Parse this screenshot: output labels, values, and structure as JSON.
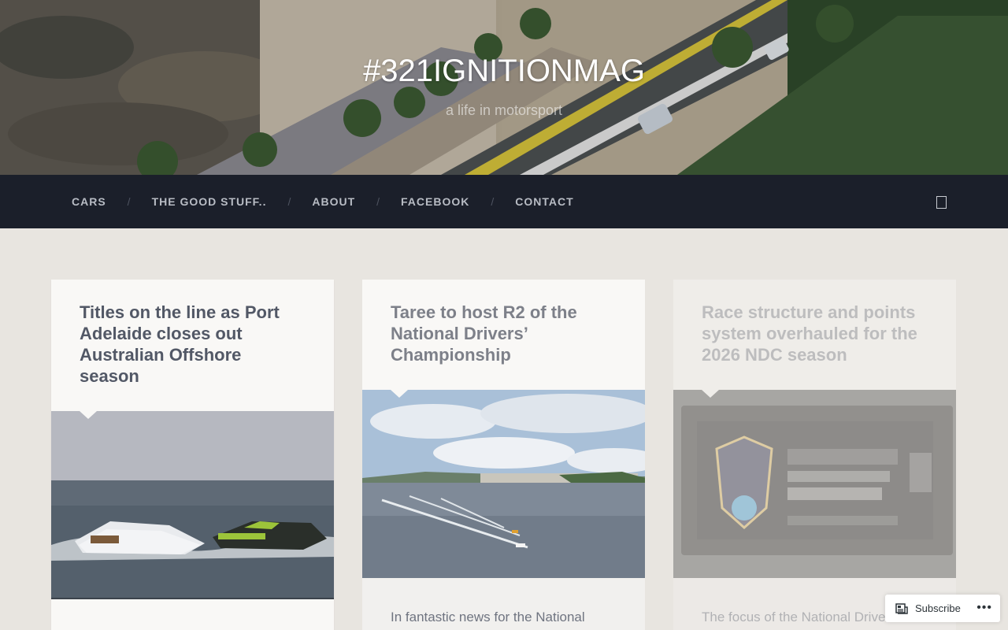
{
  "site": {
    "title": "#321IGNITIONMAG",
    "tagline": "a life in motorsport"
  },
  "nav": {
    "items": [
      {
        "label": "CARS"
      },
      {
        "label": "THE GOOD STUFF.."
      },
      {
        "label": "ABOUT"
      },
      {
        "label": "FACEBOOK"
      },
      {
        "label": "CONTACT"
      }
    ],
    "separator": "/",
    "search_icon": "search-toggle-icon"
  },
  "posts": [
    {
      "title": "Titles on the line as Port Adelaide closes out Australian Offshore season",
      "image": "offshore-powerboats-photo",
      "excerpt": ""
    },
    {
      "title": "Taree to host R2 of the National Drivers’ Championship",
      "image": "jetski-river-aerial-photo",
      "excerpt": "In fantastic news for the National"
    },
    {
      "title": "Race structure and points system overhauled for the 2026 NDC season",
      "image": "championship-banner-photo",
      "excerpt": "The focus of the National Drive"
    }
  ],
  "subscribe": {
    "label": "Subscribe",
    "more": "•••"
  },
  "colors": {
    "nav_bg": "#1b1f2a",
    "page_bg": "#e8e5e0",
    "card_bg": "#f9f8f6",
    "title_text": "#525866"
  }
}
